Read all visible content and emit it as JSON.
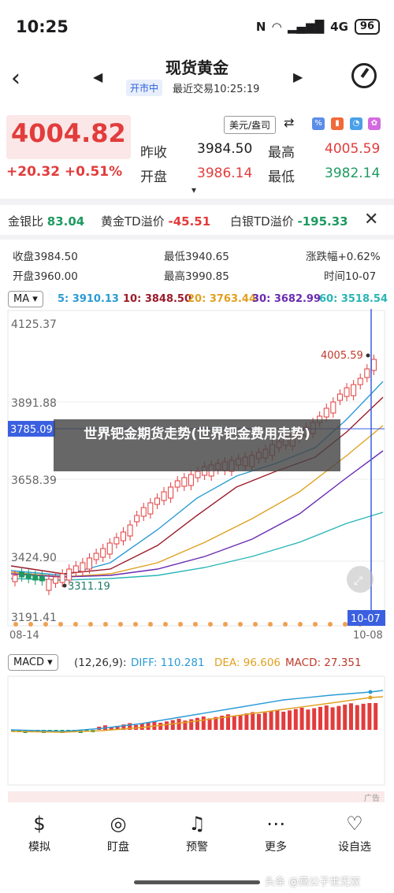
{
  "status_bar": {
    "time": "10:25",
    "signal": "4G",
    "battery": "96"
  },
  "header": {
    "title": "现货黄金",
    "market_status": "开市中",
    "last_trade": "最近交易10:25:19"
  },
  "quote": {
    "price": "4004.82",
    "change": "+20.32 +0.51%",
    "unit_select": "美元/盎司",
    "prev_close_label": "昨收",
    "prev_close": "3984.50",
    "open_label": "开盘",
    "open": "3986.14",
    "high_label": "最高",
    "high": "4005.59",
    "low_label": "最低",
    "low": "3982.14"
  },
  "ratios": {
    "gold_silver_label": "金银比",
    "gold_silver": "83.04",
    "gold_td_label": "黄金TD溢价",
    "gold_td": "-45.51",
    "silver_td_label": "白银TD溢价",
    "silver_td": "-195.33"
  },
  "candle_info": {
    "close": "收盘3984.50",
    "low": "最低3940.65",
    "pct": "涨跌幅+0.62%",
    "open": "开盘3960.00",
    "high": "最高3990.85",
    "date": "时间10-07"
  },
  "ma": {
    "select": "MA",
    "ma5": "5: 3910.13",
    "ma10": "10: 3848.50",
    "ma20": "20: 3763.44",
    "ma30": "30: 3682.99",
    "ma60": "60: 3518.54"
  },
  "chart_axis": {
    "y1": "4125.37",
    "y2": "3891.88",
    "y3": "3658.39",
    "y4": "3424.90",
    "y5": "3191.41",
    "cursor_price": "3785.09",
    "max_label": "4005.59",
    "min_label": "3311.19",
    "x_start": "08-14",
    "x_end": "10-08",
    "cursor_date": "10-07"
  },
  "overlay_text": "世界钯金期货走势(世界钯金费用走势)",
  "macd": {
    "select": "MACD",
    "params": "(12,26,9):",
    "diff": "DIFF: 110.281",
    "dea": "DEA: 96.606",
    "macd": "MACD: 27.351",
    "ad": "广告"
  },
  "nav": {
    "simulate": "模拟",
    "watch": "盯盘",
    "alert": "预警",
    "more": "更多",
    "options": "设自选"
  },
  "watermark": "头条 @燕公子世无双",
  "colors": {
    "up": "#e23c3c",
    "down": "#1e9a60",
    "ma5": "#2a9bd6",
    "ma10": "#9b1c2a",
    "ma20": "#e0a020",
    "ma30": "#6a2bb0",
    "ma60": "#2ab5b5",
    "cursor": "#3a5fe0"
  }
}
